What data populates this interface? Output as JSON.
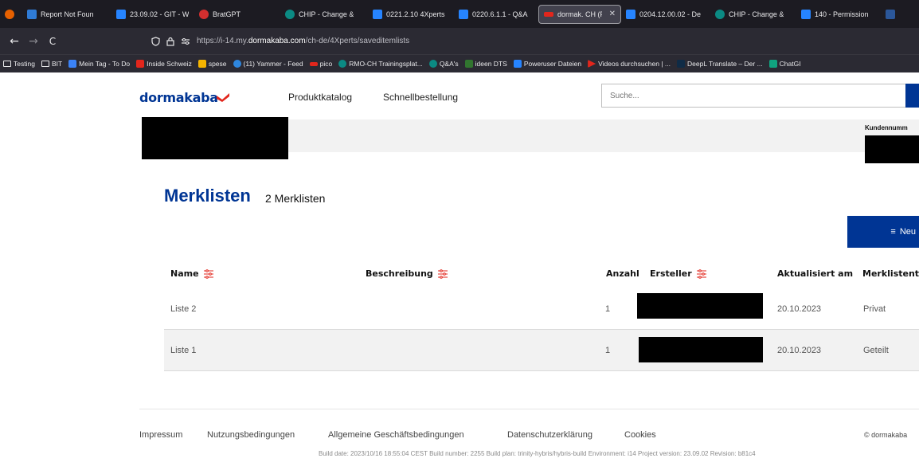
{
  "browser": {
    "tabs": [
      {
        "label": "",
        "icon": "firefox-icon",
        "color": "#e66000"
      },
      {
        "label": "Report Not Foun",
        "icon": "report-icon",
        "color": "#2f7bd6"
      },
      {
        "label": "23.09.02 - GIT - W",
        "icon": "confluence-icon",
        "color": "#2684ff"
      },
      {
        "label": "BratGPT",
        "icon": "bratgpt-icon",
        "color": "#d32f2f"
      },
      {
        "label": "CHIP - Change &",
        "icon": "sharepoint-icon",
        "color": "#0b8a83"
      },
      {
        "label": "0221.2.10 4Xperts",
        "icon": "confluence-icon",
        "color": "#2684ff"
      },
      {
        "label": "0220.6.1.1 - Q&A",
        "icon": "confluence-icon",
        "color": "#2684ff"
      },
      {
        "label": "dormak. CH (F",
        "icon": "dormakaba-icon",
        "color": "#e2261c",
        "active": true
      },
      {
        "label": "0204.12.00.02 - De",
        "icon": "confluence-icon",
        "color": "#2684ff"
      },
      {
        "label": "CHIP - Change &",
        "icon": "sharepoint-icon",
        "color": "#0b8a83"
      },
      {
        "label": "140 - Permission",
        "icon": "confluence-icon",
        "color": "#2684ff"
      },
      {
        "label": "",
        "icon": "word-icon",
        "color": "#2b579a"
      }
    ],
    "nav": {
      "back": "←",
      "forward": "→",
      "reload": "C"
    },
    "url_prefix": "https://i-14.my.",
    "url_host": "dormakaba.com",
    "url_path": "/ch-de/4Xperts/saveditemlists",
    "bookmarks": [
      {
        "label": "Testing",
        "icon": "folder-icon",
        "color": ""
      },
      {
        "label": "BIT",
        "icon": "folder-icon",
        "color": ""
      },
      {
        "label": "Mein Tag - To Do",
        "icon": "todo-icon",
        "color": "#3b82f6"
      },
      {
        "label": "Inside Schweiz",
        "icon": "dormakaba-icon",
        "color": "#e2261c"
      },
      {
        "label": "spese",
        "icon": "spese-icon",
        "color": "#f5b400"
      },
      {
        "label": "(11) Yammer - Feed",
        "icon": "yammer-icon",
        "color": "#2e86de"
      },
      {
        "label": "pico",
        "icon": "dormakaba-icon",
        "color": "#e2261c"
      },
      {
        "label": "RMO-CH Trainingsplat...",
        "icon": "sharepoint-icon",
        "color": "#0b8a83"
      },
      {
        "label": "Q&A's",
        "icon": "sharepoint-icon",
        "color": "#0b8a83"
      },
      {
        "label": "ideen DTS",
        "icon": "planner-icon",
        "color": "#31752f"
      },
      {
        "label": "Poweruser Dateien",
        "icon": "confluence-icon",
        "color": "#2684ff"
      },
      {
        "label": "Videos durchsuchen | ...",
        "icon": "video-icon",
        "color": "#e2261c"
      },
      {
        "label": "DeepL Translate – Der ...",
        "icon": "deepl-icon",
        "color": "#0f2b46"
      },
      {
        "label": "ChatGI",
        "icon": "chatgpt-icon",
        "color": "#10a37f"
      }
    ]
  },
  "site": {
    "logo": "dormakaba",
    "brand_color": "#003594",
    "accent_color": "#e2261c",
    "nav": {
      "catalog": "Produktkatalog",
      "quick_order": "Schnellbestellung"
    },
    "search_placeholder": "Suche...",
    "customer_label": "Kundennumm"
  },
  "main": {
    "title": "Merklisten",
    "count_label": "2 Merklisten",
    "new_button": "Neu",
    "columns": {
      "name": "Name",
      "description": "Beschreibung",
      "count": "Anzahl",
      "creator": "Ersteller",
      "updated": "Aktualisiert am",
      "type": "Merklistent"
    },
    "rows": [
      {
        "name": "Liste 2",
        "description": "",
        "count": "1",
        "updated": "20.10.2023",
        "type": "Privat"
      },
      {
        "name": "Liste 1",
        "description": "",
        "count": "1",
        "updated": "20.10.2023",
        "type": "Geteilt"
      }
    ]
  },
  "footer": {
    "links": [
      "Impressum",
      "Nutzungsbedingungen",
      "Allgemeine Geschäftsbedingungen",
      "Datenschutzerklärung",
      "Cookies"
    ],
    "copyright": "© dormakaba",
    "build": "Build date: 2023/10/16 18:55:04 CEST Build number: 2255 Build plan: trinity-hybris/hybris-build Environment: i14 Project version: 23.09.02 Revision: b81c4"
  }
}
